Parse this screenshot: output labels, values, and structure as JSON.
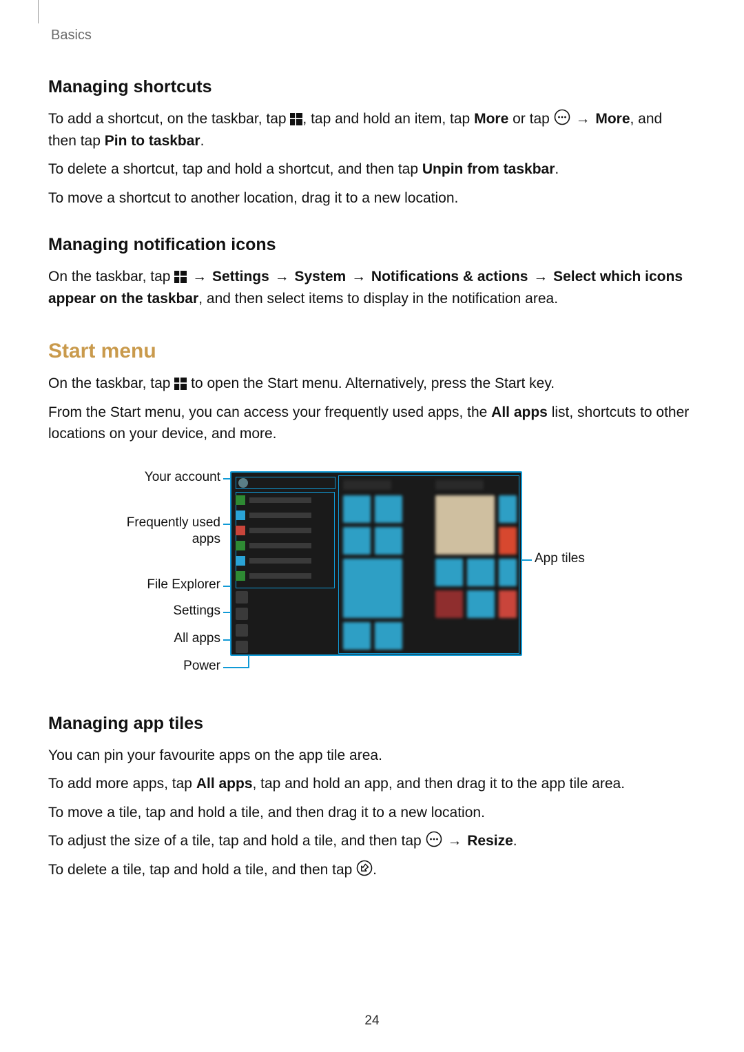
{
  "page_number": "24",
  "running_head": "Basics",
  "sections": {
    "managing_shortcuts": {
      "heading": "Managing shortcuts",
      "p1a": "To add a shortcut, on the taskbar, tap ",
      "p1b": ", tap and hold an item, tap ",
      "p1_more1": "More",
      "p1c": " or tap ",
      "p1d": " ",
      "arrow": "→",
      "p1e": " ",
      "p1_more2": "More",
      "p1f": ", and then tap ",
      "p1_pin": "Pin to taskbar",
      "p1g": ".",
      "p2a": "To delete a shortcut, tap and hold a shortcut, and then tap ",
      "p2_unpin": "Unpin from taskbar",
      "p2b": ".",
      "p3": "To move a shortcut to another location, drag it to a new location."
    },
    "managing_notifications": {
      "heading": "Managing notification icons",
      "p1a": "On the taskbar, tap ",
      "p1b": " ",
      "p1_settings": "Settings",
      "p1_system": "System",
      "p1_notif": "Notifications & actions",
      "p1_select": "Select which icons appear on the taskbar",
      "p1c": ", and then select items to display in the notification area."
    },
    "start_menu": {
      "heading": "Start menu",
      "p1a": "On the taskbar, tap ",
      "p1b": " to open the Start menu. Alternatively, press the Start key.",
      "p2a": "From the Start menu, you can access your frequently used apps, the ",
      "p2_allapps": "All apps",
      "p2b": " list, shortcuts to other locations on your device, and more."
    },
    "managing_tiles": {
      "heading": "Managing app tiles",
      "p1": "You can pin your favourite apps on the app tile area.",
      "p2a": "To add more apps, tap ",
      "p2_allapps": "All apps",
      "p2b": ", tap and hold an app, and then drag it to the app tile area.",
      "p3": "To move a tile, tap and hold a tile, and then drag it to a new location.",
      "p4a": "To adjust the size of a tile, tap and hold a tile, and then tap ",
      "p4_resize": "Resize",
      "p4b": ".",
      "p5a": "To delete a tile, tap and hold a tile, and then tap ",
      "p5b": "."
    }
  },
  "figure_callouts": {
    "your_account": "Your account",
    "frequent_l1": "Frequently used",
    "frequent_l2": "apps",
    "file_explorer": "File Explorer",
    "settings": "Settings",
    "all_apps": "All apps",
    "power": "Power",
    "app_tiles": "App tiles"
  },
  "icons": {
    "start": "start-icon",
    "more_circle": "more-options-circle-icon",
    "unpin_circle": "unpin-circle-icon"
  }
}
